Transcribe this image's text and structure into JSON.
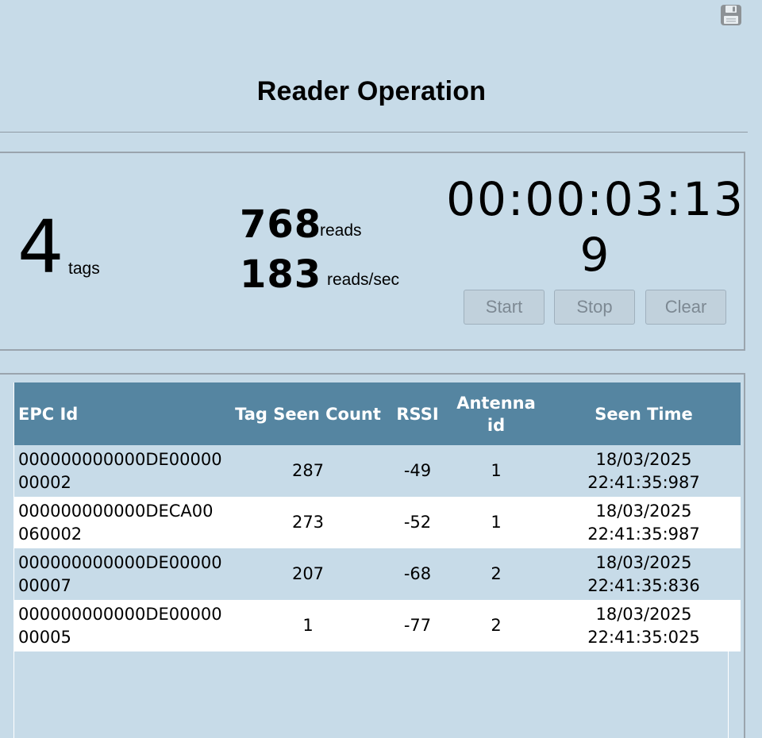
{
  "header": {
    "title": "Reader Operation",
    "save_icon": "floppy-disk-save-icon"
  },
  "stats": {
    "tags_count": "4",
    "tags_label": "tags",
    "reads_count": "768",
    "reads_label": "reads",
    "rate_count": "183",
    "rate_label": "reads/sec",
    "timer": "00:00:03:139"
  },
  "controls": {
    "start_label": "Start",
    "stop_label": "Stop",
    "clear_label": "Clear"
  },
  "table": {
    "columns": {
      "epc": "EPC Id",
      "count": "Tag Seen Count",
      "rssi": "RSSI",
      "antenna": "Antenna id",
      "time": "Seen Time"
    },
    "rows": [
      {
        "epc": "000000000000DE0000000002",
        "count": "287",
        "rssi": "-49",
        "antenna": "1",
        "date": "18/03/2025",
        "time": "22:41:35:987"
      },
      {
        "epc": "000000000000DECA00060002",
        "count": "273",
        "rssi": "-52",
        "antenna": "1",
        "date": "18/03/2025",
        "time": "22:41:35:987"
      },
      {
        "epc": "000000000000DE0000000007",
        "count": "207",
        "rssi": "-68",
        "antenna": "2",
        "date": "18/03/2025",
        "time": "22:41:35:836"
      },
      {
        "epc": "000000000000DE0000000005",
        "count": "1",
        "rssi": "-77",
        "antenna": "2",
        "date": "18/03/2025",
        "time": "22:41:35:025"
      }
    ]
  },
  "colors": {
    "background": "#c7dbe8",
    "table_header": "#5585a1",
    "row_alt": "#ffffff"
  }
}
